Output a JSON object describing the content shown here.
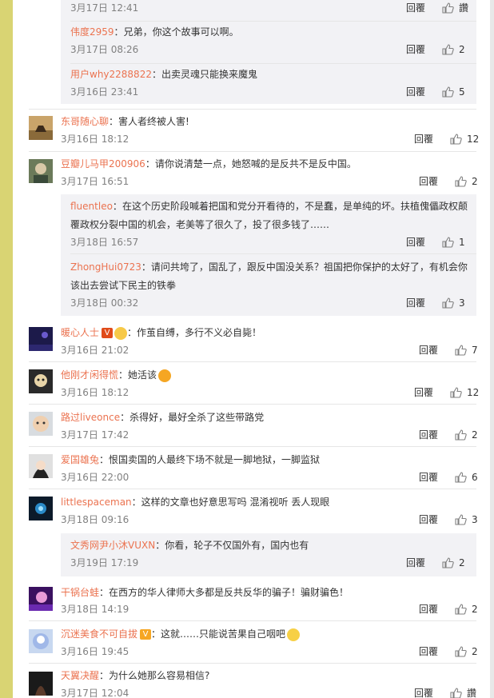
{
  "reply_label": "回覆",
  "comments": [
    {
      "kind": "sub",
      "user": "",
      "text": "",
      "time": "3月17日 12:41",
      "likes": "讚"
    },
    {
      "kind": "sub",
      "user": "伟度2959",
      "text": "兄弟，你这个故事可以啊。",
      "time": "3月17日 08:26",
      "likes": "2"
    },
    {
      "kind": "sub",
      "user": "用户why2288822",
      "text": "出卖灵魂只能换来魔鬼",
      "time": "3月16日 23:41",
      "likes": "5"
    },
    {
      "kind": "top",
      "user": "东哥随心聊",
      "text": "害人者终被人害!",
      "time": "3月16日 18:12",
      "likes": "12"
    },
    {
      "kind": "top",
      "user": "豆瓣儿马甲200906",
      "text": "请你说清楚一点，她怒喊的是反共不是反中国。",
      "time": "3月17日 16:51",
      "likes": "2"
    },
    {
      "kind": "sub",
      "user": "fluentleo",
      "text": "在这个历史阶段喊着把国和党分开看待的，不是蠢，是单纯的坏。扶植傀儡政权颠",
      "text2": "覆政权分裂中国的机会，老美等了很久了，投了很多钱了……",
      "time": "3月18日 16:57",
      "likes": "1"
    },
    {
      "kind": "sub",
      "user": "ZhongHui0723",
      "text": "请问共垮了，国乱了，跟反中国没关系？祖国把你保护的太好了，有机会你",
      "text2": "该出去尝试下民主的铁拳",
      "time": "3月18日 00:32",
      "likes": "3"
    },
    {
      "kind": "top",
      "user": "暖心人士",
      "text": "作茧自缚，多行不义必自毙！",
      "time": "3月16日 21:02",
      "likes": "7"
    },
    {
      "kind": "top",
      "user": "他刚才闲得慌",
      "text": "她活该",
      "time": "3月16日 18:12",
      "likes": "12"
    },
    {
      "kind": "top",
      "user": "路过liveonce",
      "text": "杀得好，最好全杀了这些带路党",
      "time": "3月17日 17:42",
      "likes": "2"
    },
    {
      "kind": "top",
      "user": "爱国雄兔",
      "text": "恨国卖国的人最终下场不就是一脚地狱，一脚监狱",
      "time": "3月16日 22:00",
      "likes": "6"
    },
    {
      "kind": "top",
      "user": "littlespaceman",
      "text": "这样的文章也好意思写吗 混淆视听 丢人现眼",
      "time": "3月18日 09:16",
      "likes": "3"
    },
    {
      "kind": "sub",
      "user": "文秀网尹小沐VUXN",
      "text": "你看，轮子不仅国外有，国内也有",
      "time": "3月19日 17:19",
      "likes": "2"
    },
    {
      "kind": "top",
      "user": "干锅台蛙",
      "text": "在西方的华人律师大多都是反共反华的骗子！骗财骗色！",
      "time": "3月18日 14:19",
      "likes": "2"
    },
    {
      "kind": "top",
      "user": "沉迷美食不可自拔",
      "text": "这就……只能说苦果自己咽吧",
      "time": "3月16日 19:45",
      "likes": "2"
    },
    {
      "kind": "top",
      "user": "天翼决醒",
      "text": "为什么她那么容易相信?",
      "time": "3月17日 12:04",
      "likes": "讚"
    }
  ],
  "colors": {
    "username": "#eb7350",
    "sub_bg": "#f2f2f5",
    "stripe": "#d9d473"
  }
}
